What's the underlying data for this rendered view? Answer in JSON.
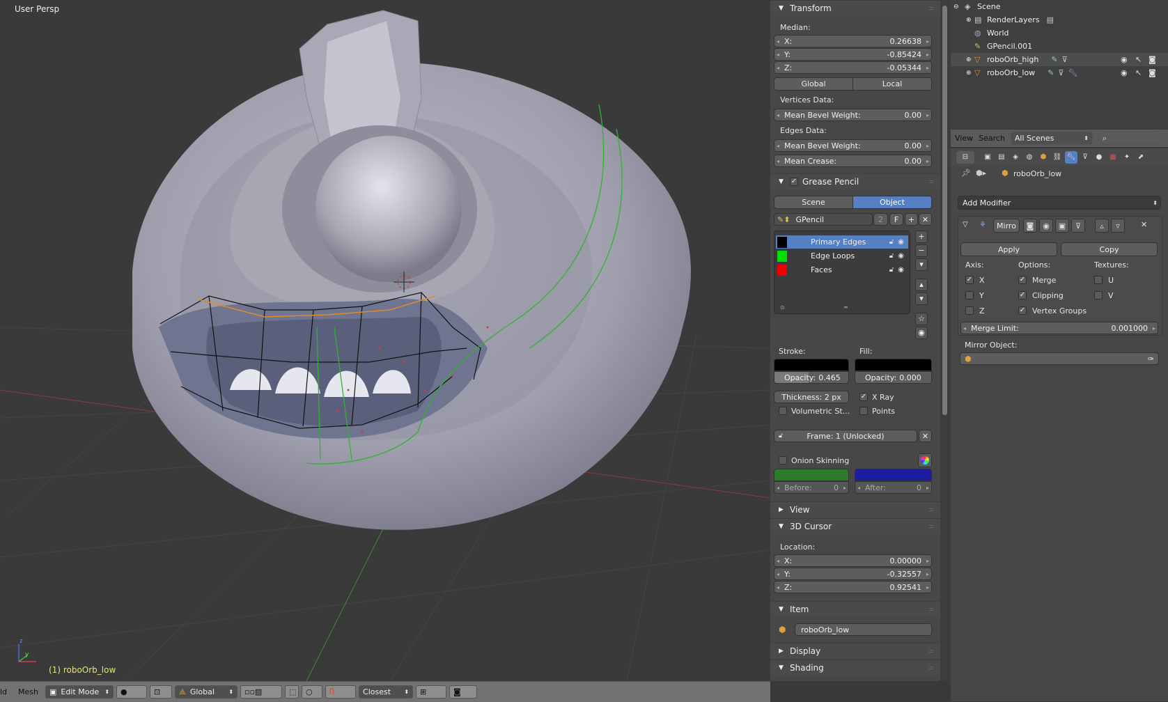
{
  "viewport": {
    "view_label": "User Persp",
    "object_label": "(1) roboOrb_low",
    "axis_z": "z",
    "axis_y": "y"
  },
  "header": {
    "left_fragment": "ld",
    "mesh_menu": "Mesh",
    "mode": "Edit Mode",
    "orientation": "Global",
    "snap_target": "Closest"
  },
  "npanel": {
    "transform": {
      "title": "Transform",
      "median_label": "Median:",
      "x_label": "X:",
      "x_value": "0.26638",
      "y_label": "Y:",
      "y_value": "-0.85424",
      "z_label": "Z:",
      "z_value": "-0.05344",
      "global_label": "Global",
      "local_label": "Local",
      "vertices_data_label": "Vertices Data:",
      "mean_bevel_weight_label": "Mean Bevel Weight:",
      "vert_bevel_value": "0.00",
      "edges_data_label": "Edges Data:",
      "edge_bevel_value": "0.00",
      "mean_crease_label": "Mean Crease:",
      "mean_crease_value": "0.00"
    },
    "grease_pencil": {
      "title": "Grease Pencil",
      "scene_label": "Scene",
      "object_label": "Object",
      "datablock_name": "GPencil",
      "users": "2",
      "fake_user": "F",
      "layers": [
        {
          "name": "Primary Edges",
          "color": "#000000"
        },
        {
          "name": "Edge Loops",
          "color": "#00dd00"
        },
        {
          "name": "Faces",
          "color": "#ee0000"
        }
      ],
      "stroke_label": "Stroke:",
      "fill_label": "Fill:",
      "stroke_opacity_label": "Opacity:",
      "stroke_opacity_value": "0.465",
      "fill_opacity_label": "Opacity:",
      "fill_opacity_value": "0.000",
      "thickness_label": "Thickness: 2 px",
      "xray_label": "X Ray",
      "volumetric_label": "Volumetric St...",
      "points_label": "Points",
      "frame_label": "Frame: 1 (Unlocked)",
      "onion_label": "Onion Skinning",
      "before_label": "Before:",
      "before_value": "0",
      "after_label": "After:",
      "after_value": "0",
      "before_color": "#2d7a2d",
      "after_color": "#1c1ca0"
    },
    "view_title": "View",
    "cursor": {
      "title": "3D Cursor",
      "location_label": "Location:",
      "x_label": "X:",
      "x_value": "0.00000",
      "y_label": "Y:",
      "y_value": "-0.32557",
      "z_label": "Z:",
      "z_value": "0.92541"
    },
    "item": {
      "title": "Item",
      "name": "roboOrb_low"
    },
    "display_title": "Display",
    "shading_title": "Shading"
  },
  "outliner": {
    "rows": [
      {
        "name": "Scene"
      },
      {
        "name": "RenderLayers"
      },
      {
        "name": "World"
      },
      {
        "name": "GPencil.001"
      },
      {
        "name": "roboOrb_high"
      },
      {
        "name": "roboOrb_low"
      }
    ],
    "view_menu": "View",
    "search_menu": "Search",
    "scenes_dropdown": "All Scenes"
  },
  "properties": {
    "object_name": "roboOrb_low",
    "add_modifier_label": "Add Modifier",
    "modifier_name": "Mirro",
    "apply_label": "Apply",
    "copy_label": "Copy",
    "axis_label": "Axis:",
    "options_label": "Options:",
    "textures_label": "Textures:",
    "axis_x": "X",
    "axis_y": "Y",
    "axis_z": "Z",
    "merge_label": "Merge",
    "clipping_label": "Clipping",
    "vertex_groups_label": "Vertex Groups",
    "tex_u": "U",
    "tex_v": "V",
    "merge_limit_label": "Merge Limit:",
    "merge_limit_value": "0.001000",
    "mirror_object_label": "Mirror Object:"
  },
  "colors": {
    "accent": "#5680c2",
    "panel_bg": "#474747",
    "viewport_bg": "#3a3a3a"
  }
}
